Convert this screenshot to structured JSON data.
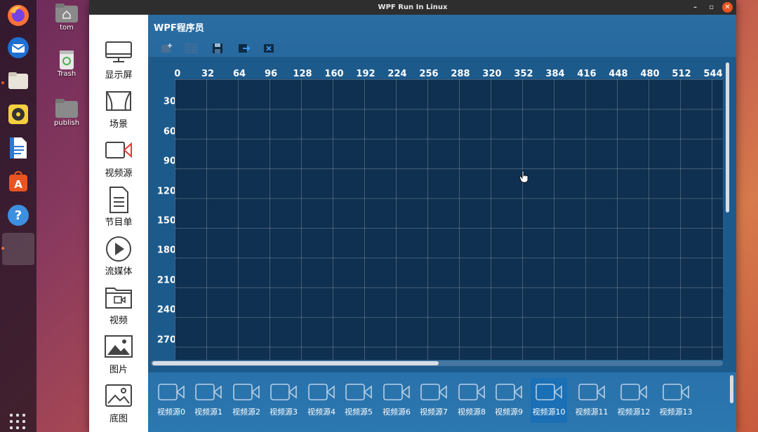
{
  "window": {
    "title": "WPF Run In Linux",
    "minimize": "–",
    "maximize": "▫",
    "close": "✕"
  },
  "desktop": {
    "icons": [
      {
        "label": "tom",
        "icon": "home-folder-icon"
      },
      {
        "label": "Trash",
        "icon": "trash-icon"
      },
      {
        "label": "publish",
        "icon": "folder-icon"
      }
    ]
  },
  "dock": {
    "apps": [
      "firefox-icon",
      "thunderbird-icon",
      "files-icon",
      "rhythmbox-icon",
      "writer-icon",
      "software-center-icon",
      "help-icon",
      "running-app-icon"
    ],
    "help_glyph": "?"
  },
  "app": {
    "title": "WPF程序员"
  },
  "sidebar": {
    "items": [
      {
        "label": "显示屏",
        "icon": "monitor-icon"
      },
      {
        "label": "场景",
        "icon": "scene-icon"
      },
      {
        "label": "视频源",
        "icon": "camera-icon"
      },
      {
        "label": "节目单",
        "icon": "document-icon"
      },
      {
        "label": "流媒体",
        "icon": "play-icon"
      },
      {
        "label": "视频",
        "icon": "video-folder-icon"
      },
      {
        "label": "图片",
        "icon": "image-icon"
      },
      {
        "label": "底图",
        "icon": "background-image-icon"
      }
    ]
  },
  "toolbar": {
    "buttons": [
      "add-screen-icon",
      "grid-icon",
      "save-icon",
      "export-icon",
      "clear-icon"
    ]
  },
  "ruler": {
    "x": [
      "0",
      "32",
      "64",
      "96",
      "128",
      "160",
      "192",
      "224",
      "256",
      "288",
      "320",
      "352",
      "384",
      "416",
      "448",
      "480",
      "512",
      "544"
    ],
    "y": [
      "30",
      "60",
      "90",
      "120",
      "150",
      "180",
      "210",
      "240",
      "270"
    ]
  },
  "sources": {
    "selected_index": 10,
    "items": [
      "视频源0",
      "视频源1",
      "视频源2",
      "视频源3",
      "视频源4",
      "视频源5",
      "视频源6",
      "视频源7",
      "视频源8",
      "视频源9",
      "视频源10",
      "视频源11",
      "视频源12",
      "视频源13"
    ]
  },
  "colors": {
    "accent": "#e95420",
    "grid_bg": "#0f3050",
    "panel": "#1d5a8c"
  }
}
